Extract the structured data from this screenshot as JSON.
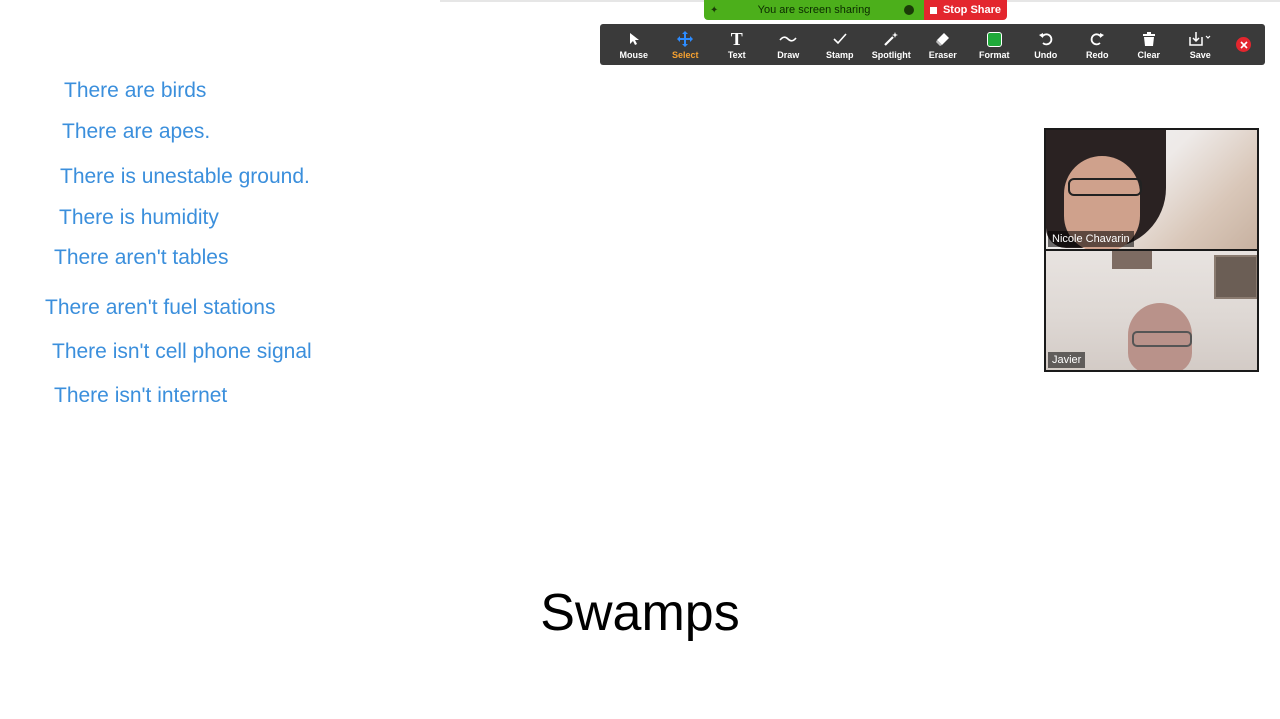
{
  "share_banner": {
    "status_text": "You are screen sharing",
    "stop_label": "Stop Share",
    "status_color": "#4caf1b",
    "stop_color": "#e3262e"
  },
  "toolbar": {
    "tools": [
      {
        "label": "Mouse",
        "icon": "cursor-arrow-icon"
      },
      {
        "label": "Select",
        "icon": "move-arrows-icon",
        "active": true
      },
      {
        "label": "Text",
        "icon": "text-t-icon"
      },
      {
        "label": "Draw",
        "icon": "squiggle-icon"
      },
      {
        "label": "Stamp",
        "icon": "checkmark-icon"
      },
      {
        "label": "Spotlight",
        "icon": "magic-wand-icon"
      },
      {
        "label": "Eraser",
        "icon": "eraser-icon"
      },
      {
        "label": "Format",
        "icon": "color-swatch-icon"
      },
      {
        "label": "Undo",
        "icon": "undo-icon"
      },
      {
        "label": "Redo",
        "icon": "redo-icon"
      },
      {
        "label": "Clear",
        "icon": "trash-icon"
      },
      {
        "label": "Save",
        "icon": "save-download-icon"
      }
    ],
    "active_color": "#f7a130",
    "format_swatch_color": "#1faa3a"
  },
  "annotations": [
    "There are birds",
    "There are apes.",
    "There is unestable ground.",
    "There is humidity",
    "There aren't tables",
    "There aren't fuel stations",
    "There isn't cell phone signal",
    "There isn't internet"
  ],
  "annotation_color": "#3b8fdc",
  "title": "Swamps",
  "participants": [
    {
      "name": "Nicole Chavarin"
    },
    {
      "name": "Javier"
    }
  ]
}
